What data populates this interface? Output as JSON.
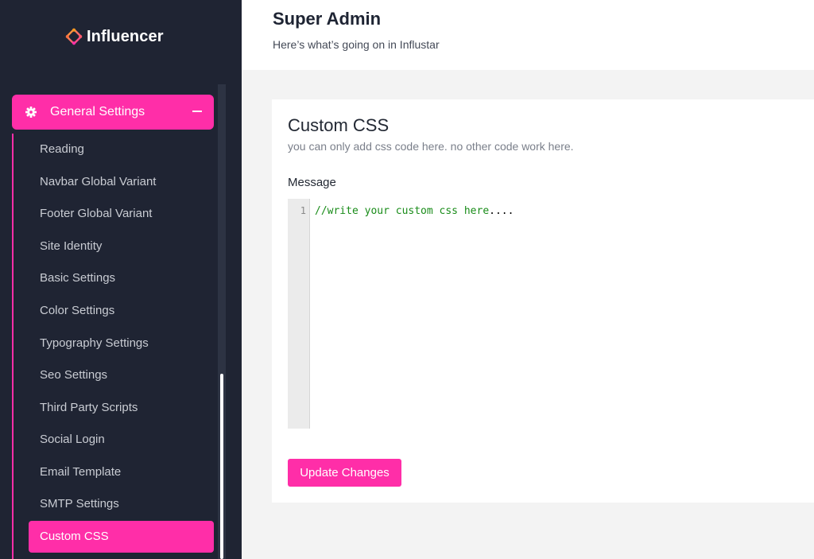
{
  "brand": {
    "name": "Influencer",
    "accent": "#ff2ea8",
    "icon": "diamond-logo-icon"
  },
  "sidebar": {
    "group": {
      "label": "General Settings",
      "icon": "gear-icon",
      "toggle_icon": "minus-icon"
    },
    "items": [
      {
        "label": "Reading"
      },
      {
        "label": "Navbar Global Variant"
      },
      {
        "label": "Footer Global Variant"
      },
      {
        "label": "Site Identity"
      },
      {
        "label": "Basic Settings"
      },
      {
        "label": "Color Settings"
      },
      {
        "label": "Typography Settings"
      },
      {
        "label": "Seo Settings"
      },
      {
        "label": "Third Party Scripts"
      },
      {
        "label": "Social Login"
      },
      {
        "label": "Email Template"
      },
      {
        "label": "SMTP Settings"
      }
    ],
    "active_item": {
      "label": "Custom CSS"
    }
  },
  "header": {
    "title": "Super Admin",
    "subtitle": "Here’s what’s going on in Influstar"
  },
  "card": {
    "title": "Custom CSS",
    "description": "you can only add css code here. no other code work here.",
    "field_label": "Message",
    "editor": {
      "line_number": "1",
      "comment": "//write your custom css here",
      "tail": "...."
    },
    "submit_label": "Update Changes"
  }
}
